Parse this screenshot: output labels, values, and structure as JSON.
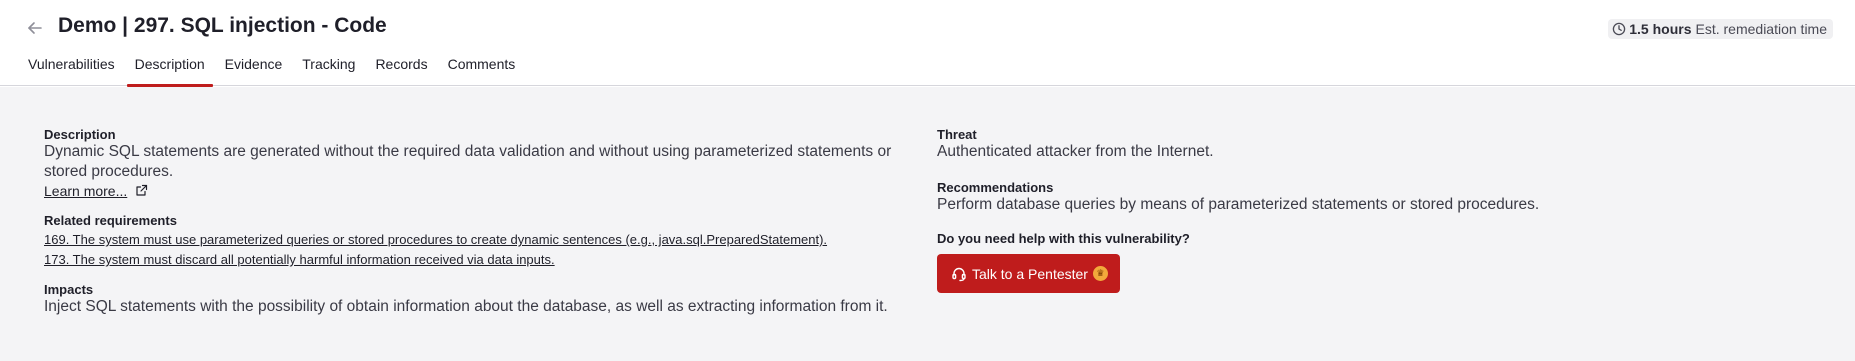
{
  "header": {
    "back_icon": "arrow-left-icon",
    "title": "Demo | 297. SQL injection - Code",
    "estimate": {
      "icon": "clock-icon",
      "hours": "1.5 hours",
      "label": "Est. remediation time"
    }
  },
  "tabs": [
    {
      "label": "Vulnerabilities",
      "active": false
    },
    {
      "label": "Description",
      "active": true
    },
    {
      "label": "Evidence",
      "active": false
    },
    {
      "label": "Tracking",
      "active": false
    },
    {
      "label": "Records",
      "active": false
    },
    {
      "label": "Comments",
      "active": false
    }
  ],
  "description": {
    "label": "Description",
    "text": "Dynamic SQL statements are generated without the required data validation and without using parameterized statements or stored procedures.",
    "learn_more": "Learn more...",
    "learn_more_icon": "external-link-icon"
  },
  "requirements": {
    "label": "Related requirements",
    "items": [
      "169. The system must use parameterized queries or stored procedures to create dynamic sentences (e.g., java.sql.PreparedStatement).",
      "173. The system must discard all potentially harmful information received via data inputs."
    ]
  },
  "impacts": {
    "label": "Impacts",
    "text": "Inject SQL statements with the possibility of obtain information about the database, as well as extracting information from it."
  },
  "threat": {
    "label": "Threat",
    "text": "Authenticated attacker from the Internet."
  },
  "recommendations": {
    "label": "Recommendations",
    "text": "Perform database queries by means of parameterized statements or stored procedures."
  },
  "help": {
    "label": "Do you need help with this vulnerability?",
    "button_label": "Talk to a Pentester",
    "button_icon": "headset-icon",
    "badge_icon": "crown-badge-icon"
  },
  "colors": {
    "accent": "#bf1c1c",
    "background": "#f4f4f6"
  }
}
